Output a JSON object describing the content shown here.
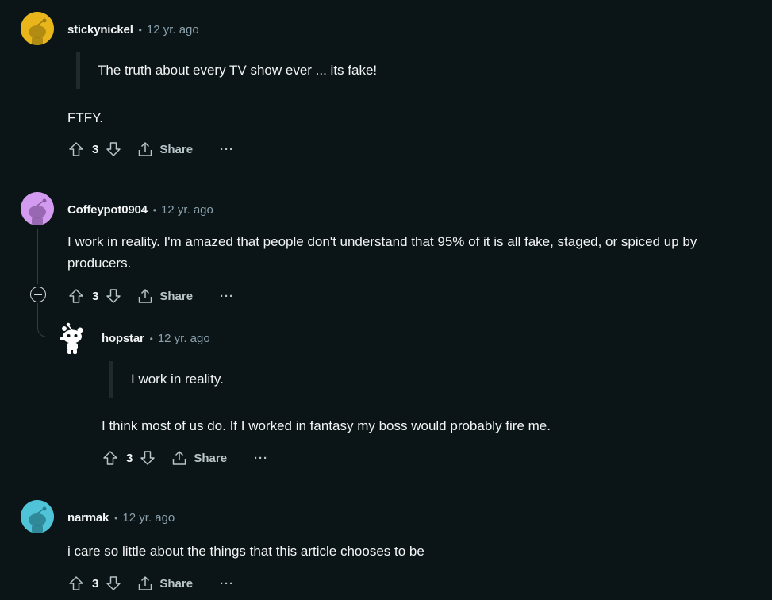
{
  "comments": [
    {
      "author": "stickynickel",
      "time": "12 yr. ago",
      "avatar_color": "#e8b61b",
      "quote": "The truth about every TV show ever ... its fake!",
      "body": "FTFY.",
      "votes": "3",
      "share_label": "Share",
      "more_label": "···"
    },
    {
      "author": "Coffeypot0904",
      "time": "12 yr. ago",
      "avatar_color": "#d39bef",
      "body_lines": [
        "I work in reality. I'm amazed that people don't understand that 95% of it is all fake, staged, or spiced up by",
        "producers."
      ],
      "votes": "3",
      "share_label": "Share",
      "more_label": "···"
    },
    {
      "author": "hopstar",
      "time": "12 yr. ago",
      "avatar_color": "#ffffff",
      "quote": "I work in reality.",
      "body": "I think most of us do. If I worked in fantasy my boss would probably fire me.",
      "votes": "3",
      "share_label": "Share",
      "more_label": "···"
    },
    {
      "author": "narmak",
      "time": "12 yr. ago",
      "avatar_color": "#4fc4d8",
      "body": "i care so little about the things that this article chooses to be",
      "votes": "3",
      "share_label": "Share",
      "more_label": "···"
    }
  ],
  "colors": {
    "background": "#0b1416",
    "text": "#f2f4f5",
    "meta": "#8ba2ad",
    "action": "#b8c5c9"
  }
}
